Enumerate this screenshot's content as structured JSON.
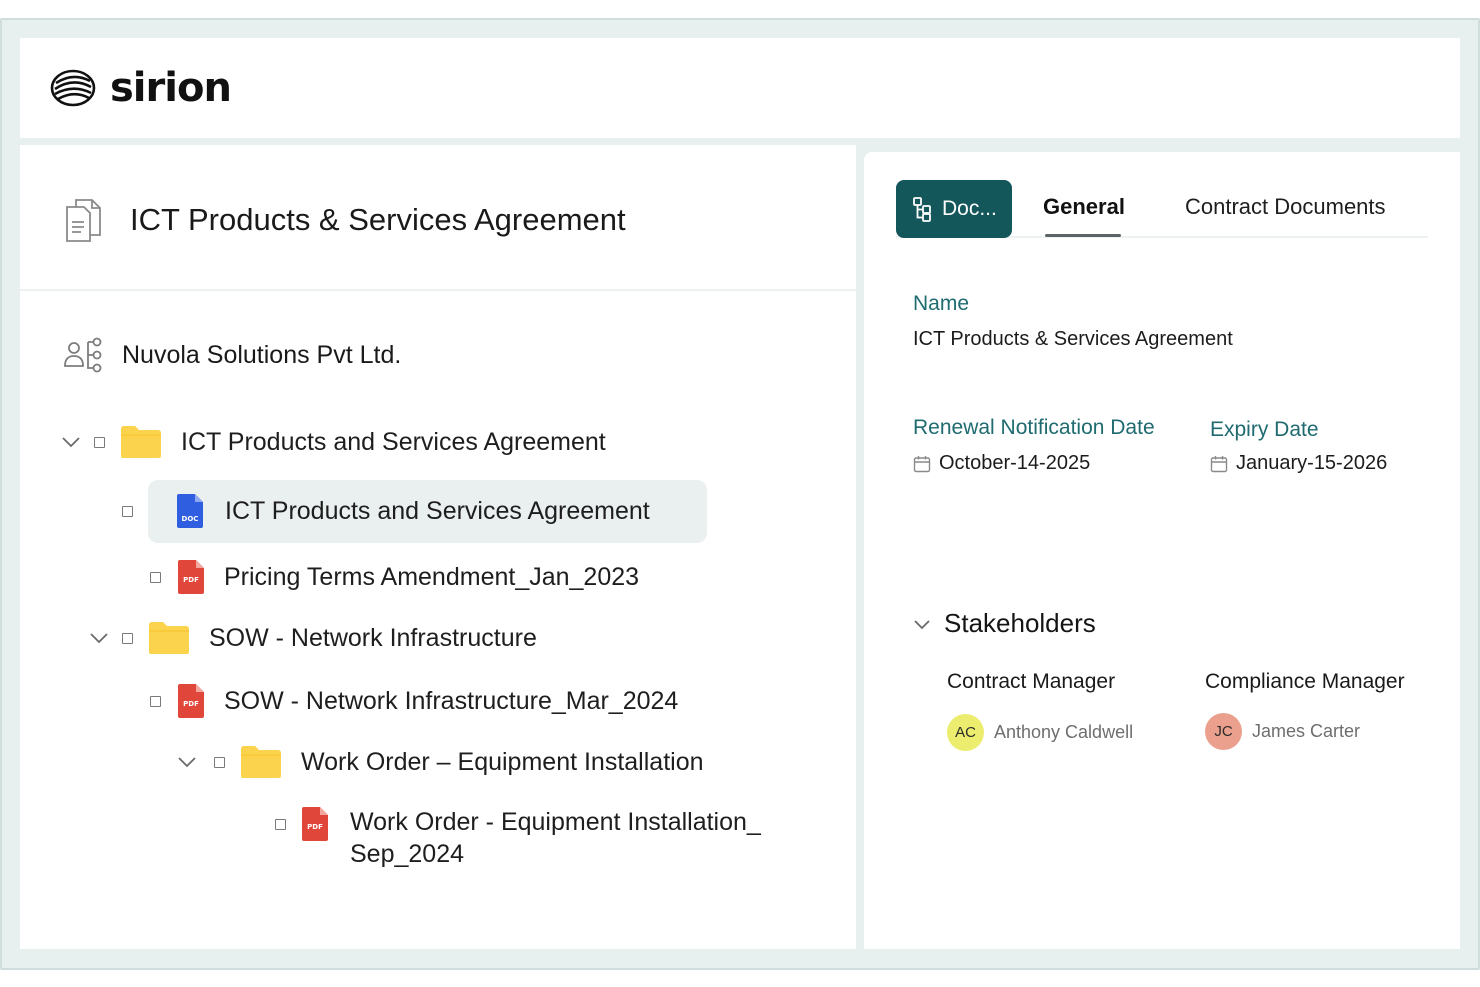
{
  "app": {
    "brand": "sirion"
  },
  "document": {
    "title": "ICT Products & Services Agreement"
  },
  "party": {
    "name": "Nuvola Solutions Pvt Ltd."
  },
  "tree": {
    "items": [
      {
        "label": "ICT Products and Services Agreement",
        "type": "folder",
        "expanded": true
      },
      {
        "label": "ICT Products and Services Agreement",
        "type": "doc",
        "badge": "DOC",
        "selected": true
      },
      {
        "label": "Pricing Terms Amendment_Jan_2023",
        "type": "pdf",
        "badge": "PDF"
      },
      {
        "label": "SOW - Network Infrastructure",
        "type": "folder",
        "expanded": true
      },
      {
        "label": "SOW - Network Infrastructure_Mar_2024",
        "type": "pdf",
        "badge": "PDF"
      },
      {
        "label": "Work Order – Equipment Installation",
        "type": "folder",
        "expanded": true
      },
      {
        "label": "Work Order - Equipment Installation_",
        "label_line2": "Sep_2024",
        "type": "pdf",
        "badge": "PDF"
      }
    ]
  },
  "tabs": {
    "doc": "Doc...",
    "general": "General",
    "contract_documents": "Contract Documents"
  },
  "general": {
    "name_label": "Name",
    "name_value": "ICT Products & Services Agreement",
    "renewal_label": "Renewal Notification Date",
    "renewal_value": "October-14-2025",
    "expiry_label": "Expiry Date",
    "expiry_value": "January-15-2026"
  },
  "stakeholders": {
    "title": "Stakeholders",
    "contract_manager_label": "Contract Manager",
    "contract_manager": {
      "initials": "AC",
      "name": "Anthony Caldwell",
      "color": "#ecec6e"
    },
    "compliance_manager_label": "Compliance Manager",
    "compliance_manager": {
      "initials": "JC",
      "name": "James Carter",
      "color": "#eaa08c"
    }
  },
  "colors": {
    "accent": "#14575b",
    "label": "#1f6b70",
    "folder": "#fcd34d",
    "pdf": "#e0473a",
    "doc": "#2f5ee0"
  }
}
